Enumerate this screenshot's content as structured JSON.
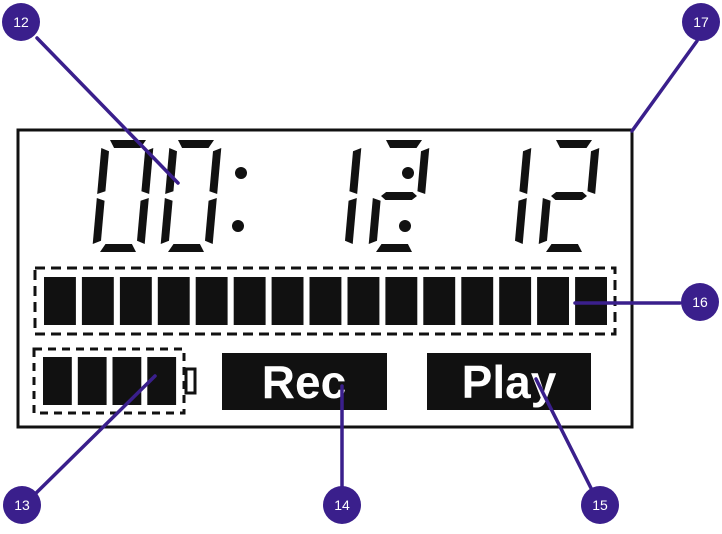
{
  "colors": {
    "callout_fill": "#3a1f8c",
    "leader_line": "#3a1f8c",
    "lcd_ink": "#111111",
    "background": "#ffffff"
  },
  "lcd": {
    "time_display": {
      "digits": [
        "0",
        "0",
        "1",
        "2",
        "1",
        "2"
      ],
      "text": "00:12:12"
    },
    "progress_bar": {
      "segments": 15,
      "filled_segments": 15
    },
    "battery": {
      "segments": 4,
      "filled_segments": 4
    },
    "rec_label": "Rec",
    "play_label": "Play"
  },
  "callouts": [
    {
      "id": "c12",
      "label": "12"
    },
    {
      "id": "c13",
      "label": "13"
    },
    {
      "id": "c14",
      "label": "14"
    },
    {
      "id": "c15",
      "label": "15"
    },
    {
      "id": "c16",
      "label": "16"
    },
    {
      "id": "c17",
      "label": "17"
    }
  ]
}
